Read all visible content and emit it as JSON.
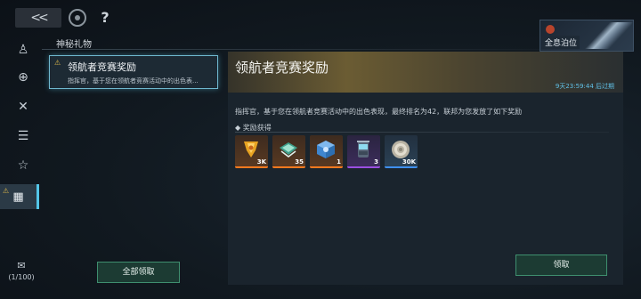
{
  "topbar": {
    "back_icon": "double-chevron-left-icon",
    "home_icon": "home-target-icon",
    "help_label": "?",
    "crew_label": "全息泊位"
  },
  "page": {
    "title": "神秘礼物"
  },
  "sidebar": {
    "items": [
      {
        "icon": "user-icon",
        "glyph": "♙"
      },
      {
        "icon": "globe-icon",
        "glyph": "⊕"
      },
      {
        "icon": "fleet-icon",
        "glyph": "✕"
      },
      {
        "icon": "notes-icon",
        "glyph": "☰"
      },
      {
        "icon": "star-icon",
        "glyph": "☆"
      },
      {
        "icon": "gift-icon",
        "glyph": "▦"
      }
    ],
    "warn_glyph": "⚠",
    "mail": {
      "icon": "mail-icon",
      "glyph": "✉",
      "count": "(1/100)"
    }
  },
  "list": {
    "items": [
      {
        "title": "领航者竞赛奖励",
        "subtitle": "指挥官，基于您在领航者竞赛活动中的出色表..."
      }
    ],
    "claim_all_label": "全部领取"
  },
  "detail": {
    "title": "领航者竞赛奖励",
    "expire": "9天23:59:44 后过期",
    "description": "指挥官，基于您在领航者竞赛活动中的出色表现，最终排名为42，联邦为您发放了如下奖励",
    "rewards_heading": "◆  奖励获得",
    "rewards": [
      {
        "name": "gold-medal-item",
        "qty": "3K",
        "rarity": "orange"
      },
      {
        "name": "blueprint-item",
        "qty": "35",
        "rarity": "orange"
      },
      {
        "name": "data-cube-item",
        "qty": "1",
        "rarity": "orange"
      },
      {
        "name": "core-canister-item",
        "qty": "3",
        "rarity": "purple"
      },
      {
        "name": "coin-item",
        "qty": "30K",
        "rarity": "blue"
      }
    ],
    "claim_label": "领取"
  },
  "colors": {
    "accent_cyan": "#54c6e8",
    "claim_green": "#3f8f6f",
    "rarity_orange": "#ff7a1f",
    "rarity_purple": "#9a4fe0",
    "rarity_blue": "#3f8ff0",
    "expire_blue": "#60c0e6"
  }
}
